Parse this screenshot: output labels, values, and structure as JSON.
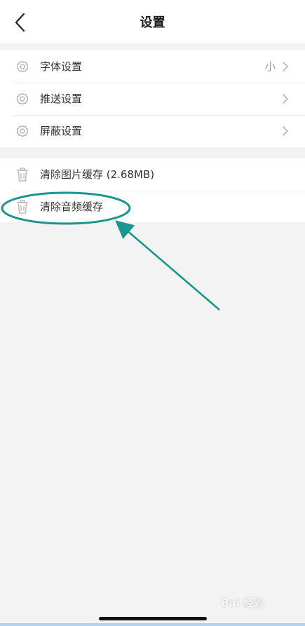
{
  "navbar": {
    "title": "设置",
    "back_icon": "back-arrow-icon"
  },
  "settings_group": {
    "items": [
      {
        "label": "字体设置",
        "value": "小",
        "icon": "gear-icon"
      },
      {
        "label": "推送设置",
        "value": "",
        "icon": "gear-icon"
      },
      {
        "label": "屏蔽设置",
        "value": "",
        "icon": "gear-icon"
      }
    ]
  },
  "cache_group": {
    "items": [
      {
        "label": "清除图片缓存 (2.68MB)",
        "icon": "trash-icon"
      },
      {
        "label": "清除音频缓存",
        "icon": "trash-icon"
      }
    ]
  },
  "annotation": {
    "color": "#1a9690",
    "target": "清除音频缓存"
  },
  "watermark": {
    "text": "Bai  经验"
  },
  "colors": {
    "background": "#f3f3f3",
    "card": "#ffffff",
    "chevron": "#b8b8b8",
    "icon": "#b0b0b0"
  }
}
